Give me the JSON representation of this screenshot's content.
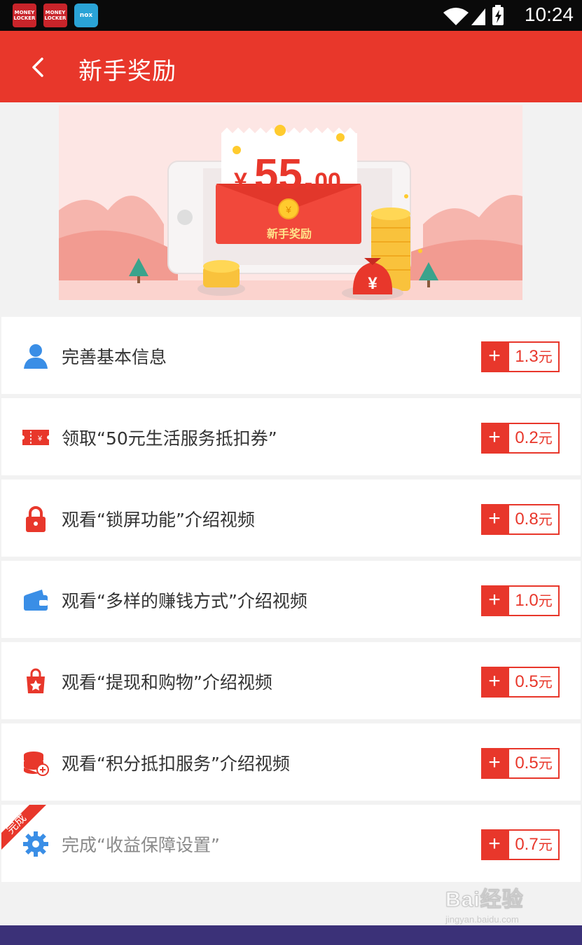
{
  "status_bar": {
    "apps": [
      {
        "name": "money-locker-app-icon",
        "label": "MONEY LOCKER"
      },
      {
        "name": "money-locker-app-icon-2",
        "label": "MONEY LOCKER"
      },
      {
        "name": "nox-app-icon",
        "label": "nox"
      }
    ],
    "time": "10:24"
  },
  "header": {
    "title": "新手奖励"
  },
  "banner": {
    "currency": "¥",
    "amount_int": "55.",
    "amount_dec": "00",
    "label": "新手奖励",
    "coin_symbol": "¥"
  },
  "tasks": [
    {
      "label": "完善基本信息",
      "reward": "1.3",
      "unit": "元",
      "icon": "user-icon",
      "color": "#3a8ee6",
      "done": false
    },
    {
      "label": "领取“50元生活服务抵扣券”",
      "reward": "0.2",
      "unit": "元",
      "icon": "coupon-icon",
      "color": "#e8372b",
      "done": false
    },
    {
      "label": "观看“锁屏功能”介绍视频",
      "reward": "0.8",
      "unit": "元",
      "icon": "lock-icon",
      "color": "#e8372b",
      "done": false
    },
    {
      "label": "观看“多样的赚钱方式”介绍视频",
      "reward": "1.0",
      "unit": "元",
      "icon": "wallet-icon",
      "color": "#3a8ee6",
      "done": false
    },
    {
      "label": "观看“提现和购物”介绍视频",
      "reward": "0.5",
      "unit": "元",
      "icon": "shopping-bag-icon",
      "color": "#e8372b",
      "done": false
    },
    {
      "label": "观看“积分抵扣服务”介绍视频",
      "reward": "0.5",
      "unit": "元",
      "icon": "coins-stack-icon",
      "color": "#e8372b",
      "done": false
    },
    {
      "label": "完成“收益保障设置”",
      "reward": "0.7",
      "unit": "元",
      "icon": "gear-icon",
      "color": "#3a8ee6",
      "done": true,
      "badge": "完成"
    }
  ],
  "reward_prefix": "+",
  "watermark": {
    "brand": "Bai经验",
    "url": "jingyan.baidu.com"
  }
}
